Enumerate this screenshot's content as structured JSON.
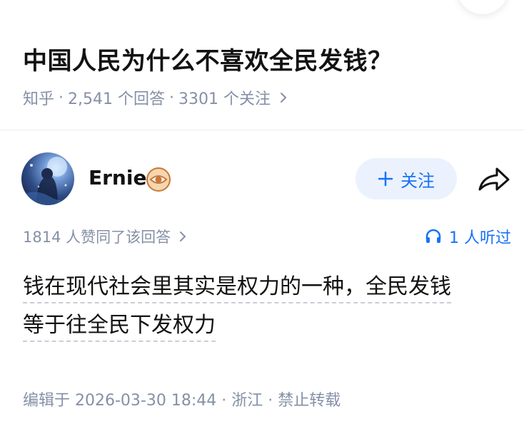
{
  "question": {
    "title": "中国人民为什么不喜欢全民发钱？",
    "meta": {
      "source": "知乎",
      "separator": "·",
      "answers": "2,541 个回答",
      "followers": "3301 个关注"
    }
  },
  "author": {
    "name": "Ernie",
    "avatar_icon": "avatar-image",
    "badge_icon": "eye-badge-icon"
  },
  "follow_button": {
    "label": "关注",
    "icon": "plus-icon"
  },
  "share_icon": "share-arrow-icon",
  "answer": {
    "votes": "1814 人赞同了该回答",
    "listeners": "1 人听过",
    "lines": [
      "钱在现代社会里其实是权力的一种，全民发钱",
      "等于往全民下发权力"
    ],
    "edit_info": "编辑于 2026-03-30 18:44 · 浙江 · 禁止转载"
  },
  "colors": {
    "accent": "#1772f6",
    "accent_bg": "#ebf2fd",
    "muted_text": "#8590a6",
    "primary_text": "#121212",
    "badge": "#e39a4f"
  }
}
